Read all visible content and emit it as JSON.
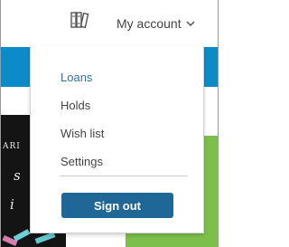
{
  "header": {
    "books_icon": "books-icon",
    "account_label": "My account",
    "chevron_icon": "chevron-down-icon"
  },
  "menu": {
    "items": [
      {
        "label": "Loans",
        "active": true
      },
      {
        "label": "Holds",
        "active": false
      },
      {
        "label": "Wish list",
        "active": false
      },
      {
        "label": "Settings",
        "active": false
      }
    ],
    "sign_out_label": "Sign out"
  },
  "background": {
    "cover_glyphs": [
      "ARI",
      "s",
      "i"
    ]
  },
  "colors": {
    "stripe_blue": "#0d8bc9",
    "accent_green": "#7cbf4a",
    "active_link": "#2f75b5",
    "button_bg": "#1f6796",
    "text": "#444444"
  }
}
